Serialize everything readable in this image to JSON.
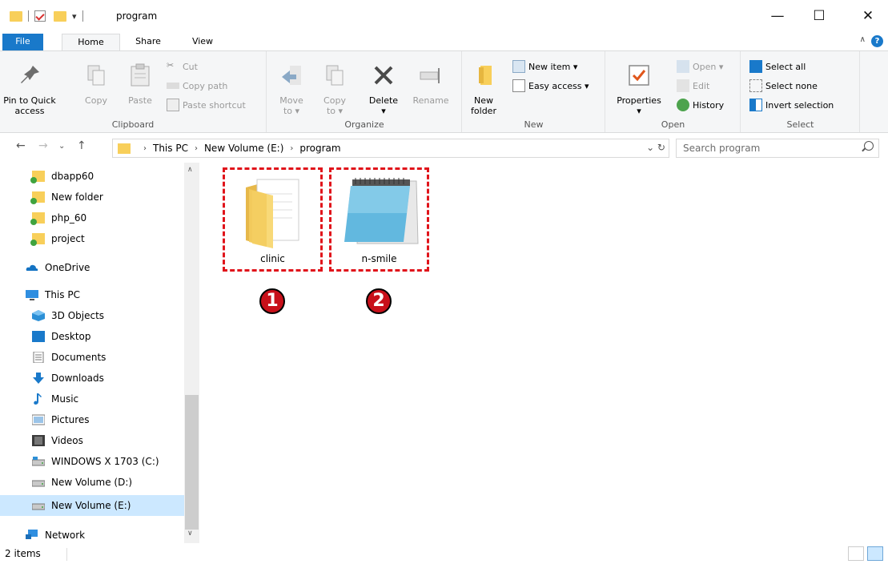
{
  "window": {
    "title": "program",
    "minimize": "—",
    "maximize": "☐",
    "close": "✕"
  },
  "ribbon_tabs": [
    "File",
    "Home",
    "Share",
    "View"
  ],
  "ribbon": {
    "clipboard": {
      "label": "Clipboard",
      "pin_to_quick_access": [
        "Pin to Quick",
        "access"
      ],
      "copy": "Copy",
      "paste": "Paste",
      "cut": "Cut",
      "copy_path": "Copy path",
      "paste_shortcut": "Paste shortcut"
    },
    "organize": {
      "label": "Organize",
      "move_to": [
        "Move",
        "to ▾"
      ],
      "copy_to": [
        "Copy",
        "to ▾"
      ],
      "delete": "Delete",
      "rename": "Rename"
    },
    "new": {
      "label": "New",
      "new_folder": [
        "New",
        "folder"
      ],
      "new_item": "New item ▾",
      "easy_access": "Easy access ▾"
    },
    "open": {
      "label": "Open",
      "properties": "Properties",
      "open": "Open ▾",
      "edit": "Edit",
      "history": "History"
    },
    "select": {
      "label": "Select",
      "select_all": "Select all",
      "select_none": "Select none",
      "invert_selection": "Invert selection"
    }
  },
  "address": {
    "crumbs": [
      "This PC",
      "New Volume (E:)",
      "program"
    ],
    "search_placeholder": "Search program"
  },
  "nav_pane": {
    "items": [
      {
        "label": "dbapp60",
        "icon": "folder-icon"
      },
      {
        "label": "New folder",
        "icon": "folder-icon"
      },
      {
        "label": "php_60",
        "icon": "folder-icon"
      },
      {
        "label": "project",
        "icon": "folder-icon"
      },
      {
        "label": "OneDrive",
        "icon": "onedrive-icon"
      },
      {
        "label": "This PC",
        "icon": "pc-icon"
      },
      {
        "label": "3D Objects",
        "icon": "3d-objects-icon"
      },
      {
        "label": "Desktop",
        "icon": "desktop-icon"
      },
      {
        "label": "Documents",
        "icon": "documents-icon"
      },
      {
        "label": "Downloads",
        "icon": "downloads-icon"
      },
      {
        "label": "Music",
        "icon": "music-icon"
      },
      {
        "label": "Pictures",
        "icon": "pictures-icon"
      },
      {
        "label": "Videos",
        "icon": "videos-icon"
      },
      {
        "label": "WINDOWS X 1703 (C:)",
        "icon": "drive-icon"
      },
      {
        "label": "New Volume (D:)",
        "icon": "drive-icon"
      },
      {
        "label": "New Volume (E:)",
        "icon": "drive-icon",
        "selected": true
      },
      {
        "label": "Network",
        "icon": "network-icon"
      }
    ]
  },
  "files": [
    {
      "name": "clinic",
      "type": "folder",
      "marker": "1"
    },
    {
      "name": "n-smile",
      "type": "notepad",
      "marker": "2"
    }
  ],
  "status": {
    "item_count": "2 items"
  },
  "colors": {
    "accent": "#1979ca",
    "annotation_red": "#e0141b",
    "folder_yellow": "#f8cf5a",
    "selected_bg": "#cce8ff"
  }
}
